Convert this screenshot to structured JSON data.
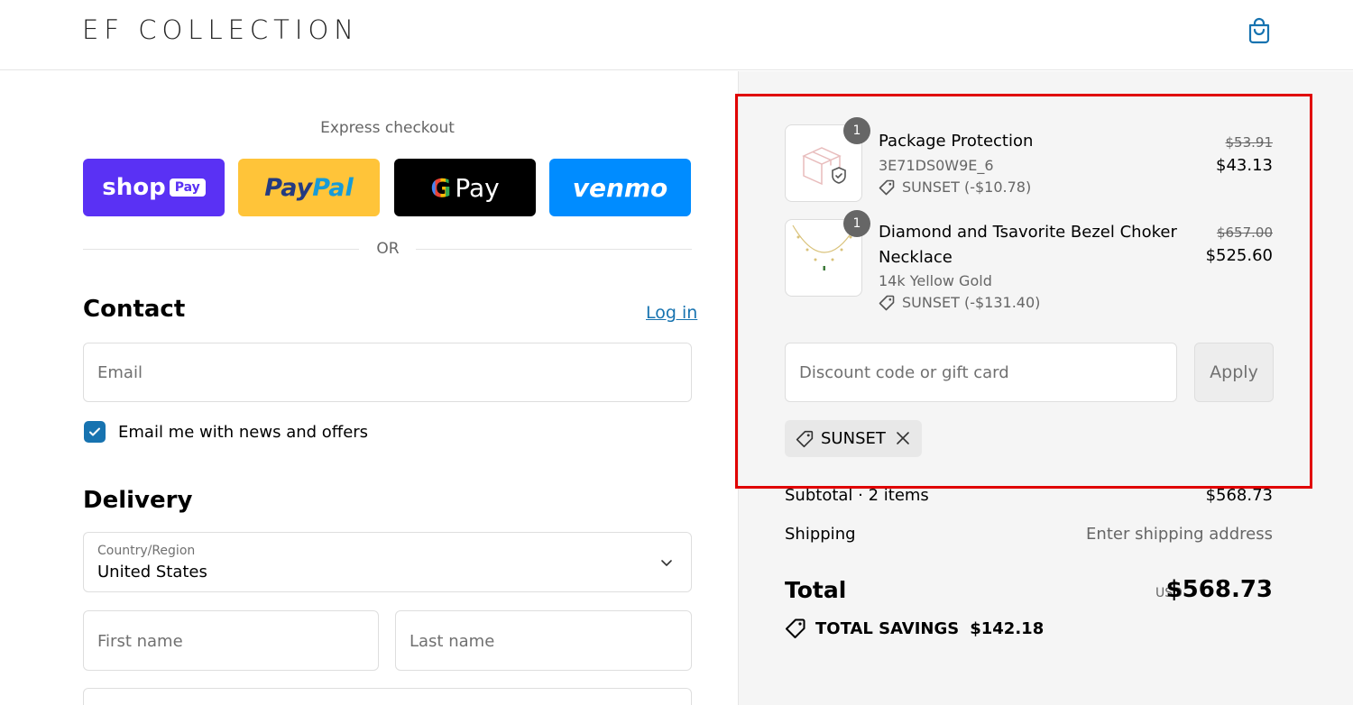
{
  "header": {
    "logo": "EF COLLECTION",
    "bag_icon": "shopping-bag-icon"
  },
  "express": {
    "label": "Express checkout",
    "shop_text": "shop",
    "shop_pill": "Pay",
    "paypal_a": "Pay",
    "paypal_b": "Pal",
    "gpay_g": "G",
    "gpay_text": "Pay",
    "venmo_text": "venmo",
    "or_text": "OR"
  },
  "contact": {
    "title": "Contact",
    "login": "Log in",
    "email_placeholder": "Email",
    "newsletter_label": "Email me with news and offers",
    "newsletter_checked": true
  },
  "delivery": {
    "title": "Delivery",
    "country_label": "Country/Region",
    "country_value": "United States",
    "first_name_placeholder": "First name",
    "last_name_placeholder": "Last name"
  },
  "cart": {
    "items": [
      {
        "qty": "1",
        "name": "Package Protection",
        "variant": "3E71DS0W9E_6",
        "discount": "SUNSET (-$10.78)",
        "old_price": "$53.91",
        "price": "$43.13"
      },
      {
        "qty": "1",
        "name_line1": "Diamond and Tsavorite Bezel Choker",
        "name_line2": "Necklace",
        "variant": "14k Yellow Gold",
        "discount": "SUNSET (-$131.40)",
        "old_price": "$657.00",
        "price": "$525.60"
      }
    ],
    "discount_placeholder": "Discount code or gift card",
    "apply_label": "Apply",
    "applied_code": "SUNSET"
  },
  "summary": {
    "subtotal_label": "Subtotal · 2 items",
    "subtotal_value": "$568.73",
    "shipping_label": "Shipping",
    "shipping_value": "Enter shipping address",
    "total_label": "Total",
    "currency": "USD",
    "total_value": "$568.73",
    "savings_label": "TOTAL SAVINGS",
    "savings_value": "$142.18"
  },
  "colors": {
    "link": "#1773b0",
    "shop_pay": "#5a31f4",
    "paypal": "#ffc439",
    "venmo": "#008cff",
    "highlight": "#e00000"
  }
}
